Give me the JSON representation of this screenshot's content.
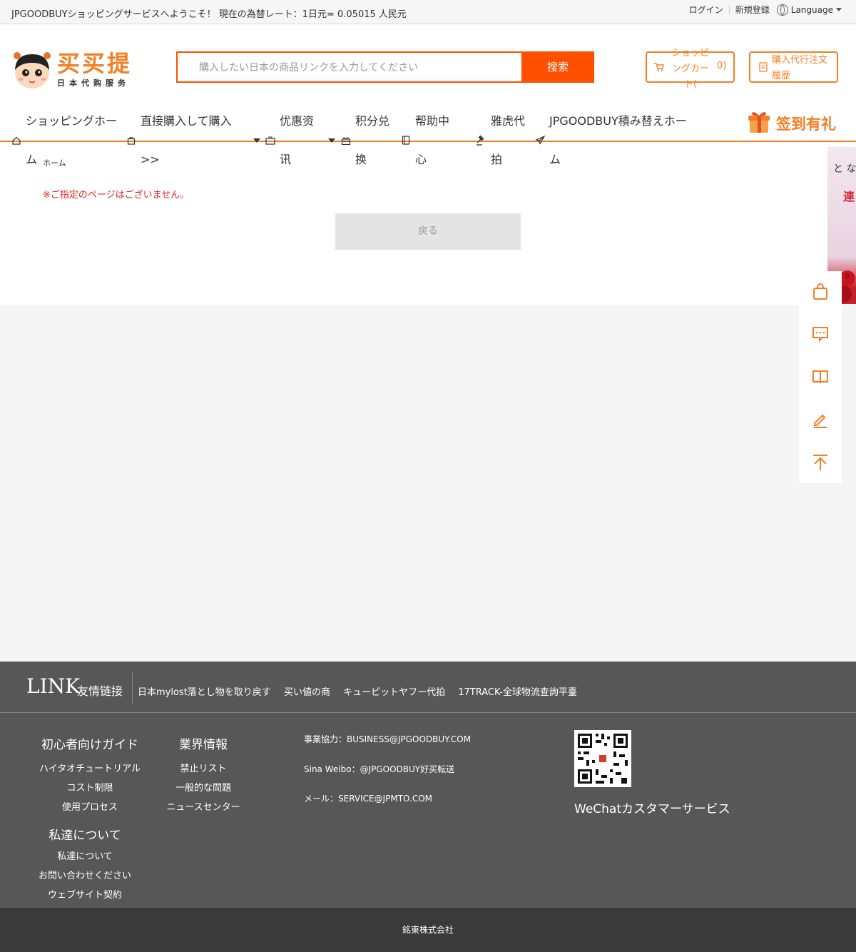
{
  "topbar": {
    "welcome": "JPGOODBUYショッピングサービスへようこそ！ 現在の為替レート：1日元= 0.05015 人民元",
    "login": "ログイン",
    "register": "新規登録",
    "language": "Language"
  },
  "logo": {
    "brand": "买买提",
    "sub": "日本代购服务"
  },
  "search": {
    "placeholder": "購入したい日本の商品リンクを入力してください",
    "button": "搜索"
  },
  "header": {
    "cart_label": "ショッピングカート(",
    "cart_count": "0)",
    "history_label": "購入代行注文履歴"
  },
  "nav": {
    "items": [
      {
        "label_l1": "ショッピングホー",
        "label_l2": "ム"
      },
      {
        "label_l1": "直接購入して購入",
        "label_l2": ">>"
      },
      {
        "label_l1": "优惠资",
        "label_l2": "讯"
      },
      {
        "label_l1": "积分兑",
        "label_l2": "换"
      },
      {
        "label_l1": "帮助中",
        "label_l2": "心"
      },
      {
        "label_l1": "雅虎代",
        "label_l2": "拍"
      },
      {
        "label_l1": "JPGOODBUY積み替えホー",
        "label_l2": "ム"
      }
    ],
    "checkin": "签到有礼"
  },
  "breadcrumb": "ホーム",
  "error_message": "※ご指定のページはございません。",
  "back_button": "戻る",
  "side_ad": {
    "line1": "と な",
    "line2": "連"
  },
  "footer_link": {
    "title_big": "LINK",
    "title_small": "友情链接",
    "links": [
      "日本mylost落とし物を取り戻す",
      "买い値の商",
      "キューピットヤフー代拍",
      "17TRACK-全球物流查詢平臺"
    ]
  },
  "footer": {
    "guide": {
      "heading": "初心者向けガイド",
      "items": [
        "ハイタオチュートリアル",
        "コスト制限",
        "使用プロセス"
      ]
    },
    "industry": {
      "heading": "業界情報",
      "items": [
        "禁止リスト",
        "一般的な問題",
        "ニュースセンター"
      ]
    },
    "about": {
      "heading": "私達について",
      "items": [
        "私達について",
        "お問い合わせください",
        "ウェブサイト契約"
      ]
    },
    "contact": {
      "business": "事業協力：BUSINESS@JPGOODBUY.COM",
      "weibo": "Sina Weibo：@JPGOODBUY好买転送",
      "mail": "メール：SERVICE@JPMTO.COM"
    },
    "wechat": "WeChatカスタマーサービス"
  },
  "copyright": "銘東株式会社",
  "colors": {
    "accent": "#f57e24",
    "search_button": "#ff5000",
    "error": "#e0261d",
    "footer_bg": "#575757"
  }
}
